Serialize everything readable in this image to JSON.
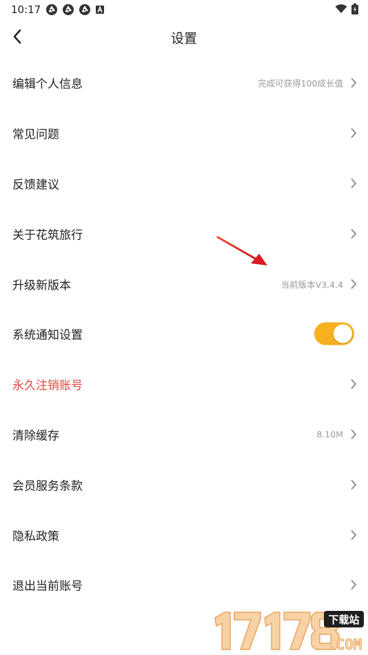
{
  "status_bar": {
    "time": "10:17",
    "left_icons": [
      "aperture-icon",
      "aperture-icon",
      "aperture-icon",
      "a-badge-icon"
    ],
    "right_icons": [
      "wifi-icon",
      "battery-icon"
    ]
  },
  "header": {
    "title": "设置",
    "back_icon": "chevron-left-icon"
  },
  "settings": {
    "items": [
      {
        "label": "编辑个人信息",
        "value": "完成可获得100成长值",
        "type": "link"
      },
      {
        "label": "常见问题",
        "value": "",
        "type": "link"
      },
      {
        "label": "反馈建议",
        "value": "",
        "type": "link"
      },
      {
        "label": "关于花筑旅行",
        "value": "",
        "type": "link"
      },
      {
        "label": "升级新版本",
        "value": "当前版本V3.4.4",
        "type": "link"
      },
      {
        "label": "系统通知设置",
        "value": "",
        "type": "toggle",
        "on": true
      },
      {
        "label": "永久注销账号",
        "value": "",
        "type": "link",
        "danger": true
      },
      {
        "label": "清除缓存",
        "value": "8.10M",
        "type": "link"
      },
      {
        "label": "会员服务条款",
        "value": "",
        "type": "link"
      },
      {
        "label": "隐私政策",
        "value": "",
        "type": "link"
      },
      {
        "label": "退出当前账号",
        "value": "",
        "type": "link"
      }
    ]
  },
  "colors": {
    "accent_toggle": "#f6b020",
    "danger_text": "#e8453c",
    "secondary_text": "#9a9a9a",
    "annotation_arrow": "#e0201e"
  },
  "watermark": {
    "digits": "17178",
    "badge": "下载站",
    "domain": ".COM"
  }
}
